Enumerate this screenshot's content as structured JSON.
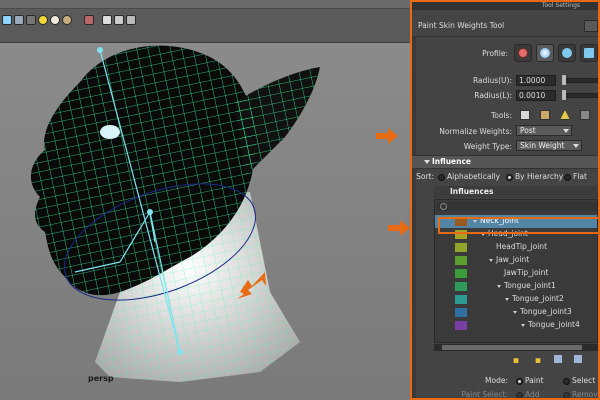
{
  "viewport": {
    "label": "persp",
    "toolbar_icons": [
      "isolate-icon",
      "shaded-icon",
      "light-icon",
      "sun-icon",
      "camera-icon",
      "grid-icon",
      "cube-icon",
      "shuffle-icon"
    ]
  },
  "panel": {
    "header": "Tool Settings",
    "title": "Paint Skin Weights Tool",
    "profile_label": "Profile:",
    "radius_u_label": "Radius(U):",
    "radius_u_value": "1.0000",
    "radius_l_label": "Radius(L):",
    "radius_l_value": "0.0010",
    "tools_label": "Tools:",
    "normalize_label": "Normalize Weights:",
    "normalize_value": "Post",
    "weight_type_label": "Weight Type:",
    "weight_type_value": "Skin Weight",
    "influence_section": "Influence",
    "sort_label": "Sort:",
    "sort_options": [
      "Alphabetically",
      "By Hierarchy",
      "Flat"
    ],
    "sort_selected": "By Hierarchy",
    "influences_title": "Influences",
    "joints": [
      {
        "name": "Neck_joint",
        "color": "#9a5a1f",
        "depth": 0,
        "expanded": true,
        "selected": true
      },
      {
        "name": "Head_joint",
        "color": "#a6a325",
        "depth": 1,
        "expanded": true,
        "selected": false
      },
      {
        "name": "HeadTip_joint",
        "color": "#8fa62a",
        "depth": 2,
        "expanded": false,
        "selected": false
      },
      {
        "name": "Jaw_joint",
        "color": "#5d9f2e",
        "depth": 2,
        "expanded": true,
        "selected": false
      },
      {
        "name": "JawTip_joint",
        "color": "#3b9c3a",
        "depth": 3,
        "expanded": false,
        "selected": false
      },
      {
        "name": "Tongue_joint1",
        "color": "#2f9a5b",
        "depth": 3,
        "expanded": true,
        "selected": false
      },
      {
        "name": "Tongue_joint2",
        "color": "#2a9a93",
        "depth": 4,
        "expanded": true,
        "selected": false
      },
      {
        "name": "Tongue_joint3",
        "color": "#2f6fa2",
        "depth": 5,
        "expanded": true,
        "selected": false
      },
      {
        "name": "Tongue_joint4",
        "color": "#7a3fa5",
        "depth": 6,
        "expanded": true,
        "selected": false
      }
    ],
    "mode_label": "Mode:",
    "mode_options": [
      "Paint",
      "Select"
    ],
    "mode_selected": "Paint",
    "paint_select_label": "Paint Select:",
    "paint_select_options": [
      "Add",
      "Remove"
    ]
  },
  "colors": {
    "annotation_orange": "#e86a12",
    "wireframe": "#3cff9f",
    "joint_blue": "#7fe3f0",
    "selection_row": "#5285a6"
  }
}
